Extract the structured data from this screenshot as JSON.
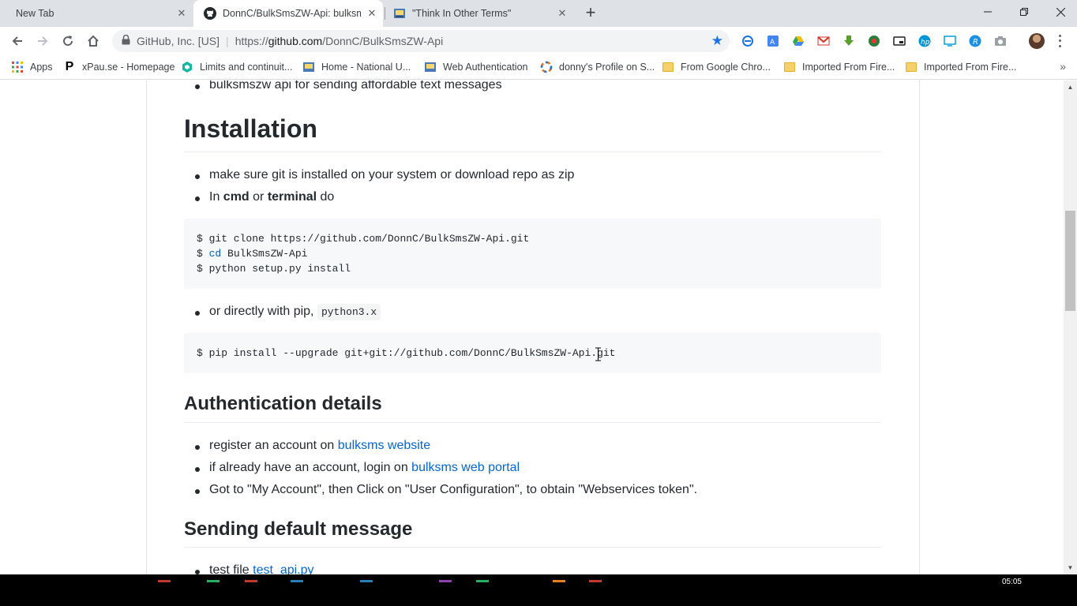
{
  "browser": {
    "tabs": [
      {
        "title": "New Tab",
        "active": false
      },
      {
        "title": "DonnC/BulkSmsZW-Api: bulksms",
        "active": true
      },
      {
        "title": "\"Think In Other Terms\"",
        "active": false
      }
    ],
    "omnibox": {
      "org": "GitHub, Inc. [US]",
      "url_scheme": "https://",
      "url_host": "github.com",
      "url_path": "/DonnC/BulkSmsZW-Api"
    },
    "bookmarks": [
      {
        "label": "Apps",
        "icon": "apps-grid-icon"
      },
      {
        "label": "xPau.se - Homepage",
        "icon": "p-logo-icon"
      },
      {
        "label": "Limits and continuit...",
        "icon": "hexagon-icon"
      },
      {
        "label": "Home - National U...",
        "icon": "site-icon"
      },
      {
        "label": "Web Authentication",
        "icon": "site-icon"
      },
      {
        "label": "donny's Profile on S...",
        "icon": "ring-icon"
      },
      {
        "label": "From Google Chro...",
        "icon": "folder-icon"
      },
      {
        "label": "Imported From Fire...",
        "icon": "folder-icon"
      },
      {
        "label": "Imported From Fire...",
        "icon": "folder-icon"
      }
    ]
  },
  "readme": {
    "top_item": "bulksmszw api for sending affordable text messages",
    "installation": {
      "heading": "Installation",
      "item1": "make sure git is installed on your system or download repo as zip",
      "item2_pre": "In ",
      "item2_b1": "cmd",
      "item2_mid": " or ",
      "item2_b2": "terminal",
      "item2_post": " do",
      "code1_line1": "$ git clone https://github.com/DonnC/BulkSmsZW-Api.git",
      "code1_line2_prefix": "$ ",
      "code1_line2_kw": "cd",
      "code1_line2_rest": " BulkSmsZW-Api",
      "code1_line3": "$ python setup.py install",
      "item3_pre": "or directly with pip, ",
      "item3_code": "python3.x",
      "code2_line1": "$ pip install --upgrade git+git://github.com/DonnC/BulkSmsZW-Api.git"
    },
    "auth": {
      "heading": "Authentication details",
      "item1_pre": "register an account on ",
      "item1_link": "bulksms website",
      "item2_pre": "if already have an account, login on ",
      "item2_link": "bulksms web portal",
      "item3": "Got to \"My Account\", then Click on \"User Configuration\", to obtain \"Webservices token\"."
    },
    "sending": {
      "heading": "Sending default message",
      "item1_pre": "test file ",
      "item1_link": "test_api.py"
    }
  },
  "taskbar": {
    "clock": "05:05"
  },
  "colors": {
    "link": "#0366d6",
    "star": "#1a73e8"
  }
}
